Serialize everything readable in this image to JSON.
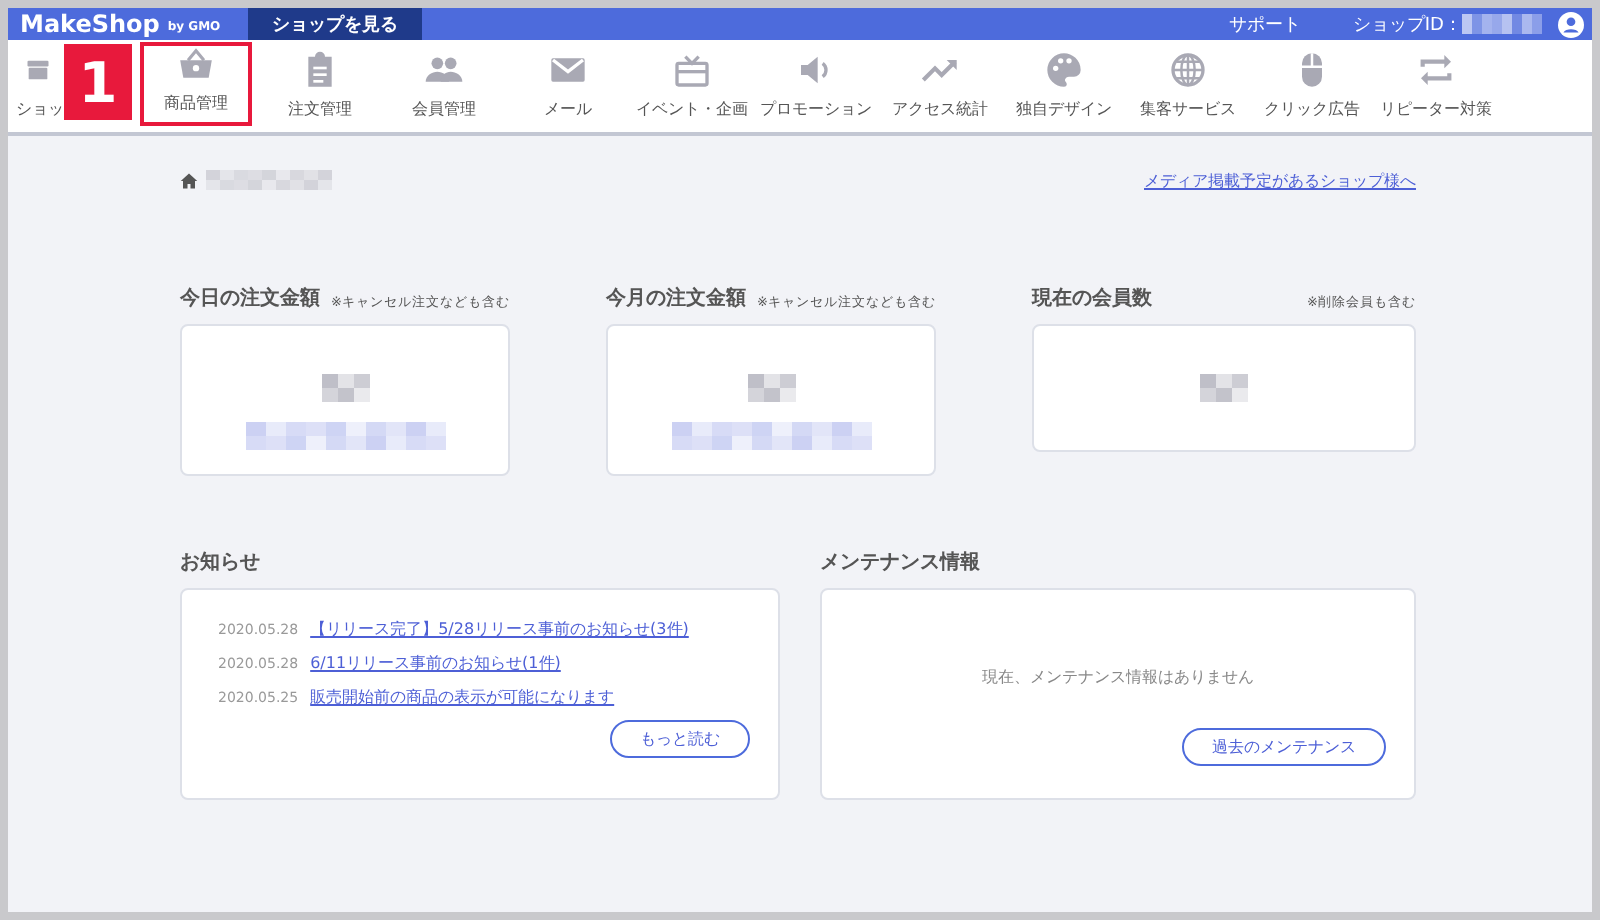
{
  "topbar": {
    "logo": "MakeShop",
    "logo_suffix": "by GMO",
    "view_shop_button": "ショップを見る",
    "support_link": "サポート",
    "shop_id_label": "ショップID："
  },
  "annotation": {
    "number": "1"
  },
  "nav": [
    {
      "kind": "shop",
      "label": "ショッ",
      "highlighted": false
    },
    {
      "kind": "basket",
      "label": "商品管理",
      "highlighted": true
    },
    {
      "kind": "clipboard",
      "label": "注文管理",
      "highlighted": false
    },
    {
      "kind": "people",
      "label": "会員管理",
      "highlighted": false
    },
    {
      "kind": "mail",
      "label": "メール",
      "highlighted": false
    },
    {
      "kind": "gift",
      "label": "イベント・企画",
      "highlighted": false
    },
    {
      "kind": "speaker",
      "label": "プロモーション",
      "highlighted": false
    },
    {
      "kind": "trend",
      "label": "アクセス統計",
      "highlighted": false
    },
    {
      "kind": "palette",
      "label": "独自デザイン",
      "highlighted": false
    },
    {
      "kind": "globe",
      "label": "集客サービス",
      "highlighted": false
    },
    {
      "kind": "mouse",
      "label": "クリック広告",
      "highlighted": false
    },
    {
      "kind": "repeat",
      "label": "リピーター対策",
      "highlighted": false
    }
  ],
  "media_link": "メディア掲載予定があるショップ様へ",
  "stats": [
    {
      "title": "今日の注文金額",
      "note": "※キャンセル注文なども含む",
      "kind": "tall"
    },
    {
      "title": "今月の注文金額",
      "note": "※キャンセル注文なども含む",
      "kind": "tall"
    },
    {
      "title": "現在の会員数",
      "note": "※削除会員も含む",
      "kind": "short"
    }
  ],
  "news": {
    "title": "お知らせ",
    "items": [
      {
        "date": "2020.05.28",
        "text": "【リリース完了】5/28リリース事前のお知らせ(3件)"
      },
      {
        "date": "2020.05.28",
        "text": "6/11リリース事前のお知らせ(1件)"
      },
      {
        "date": "2020.05.25",
        "text": "販売開始前の商品の表示が可能になります"
      }
    ],
    "button": "もっと読む"
  },
  "maintenance": {
    "title": "メンテナンス情報",
    "message": "現在、メンテナンス情報はありません",
    "button": "過去のメンテナンス"
  }
}
